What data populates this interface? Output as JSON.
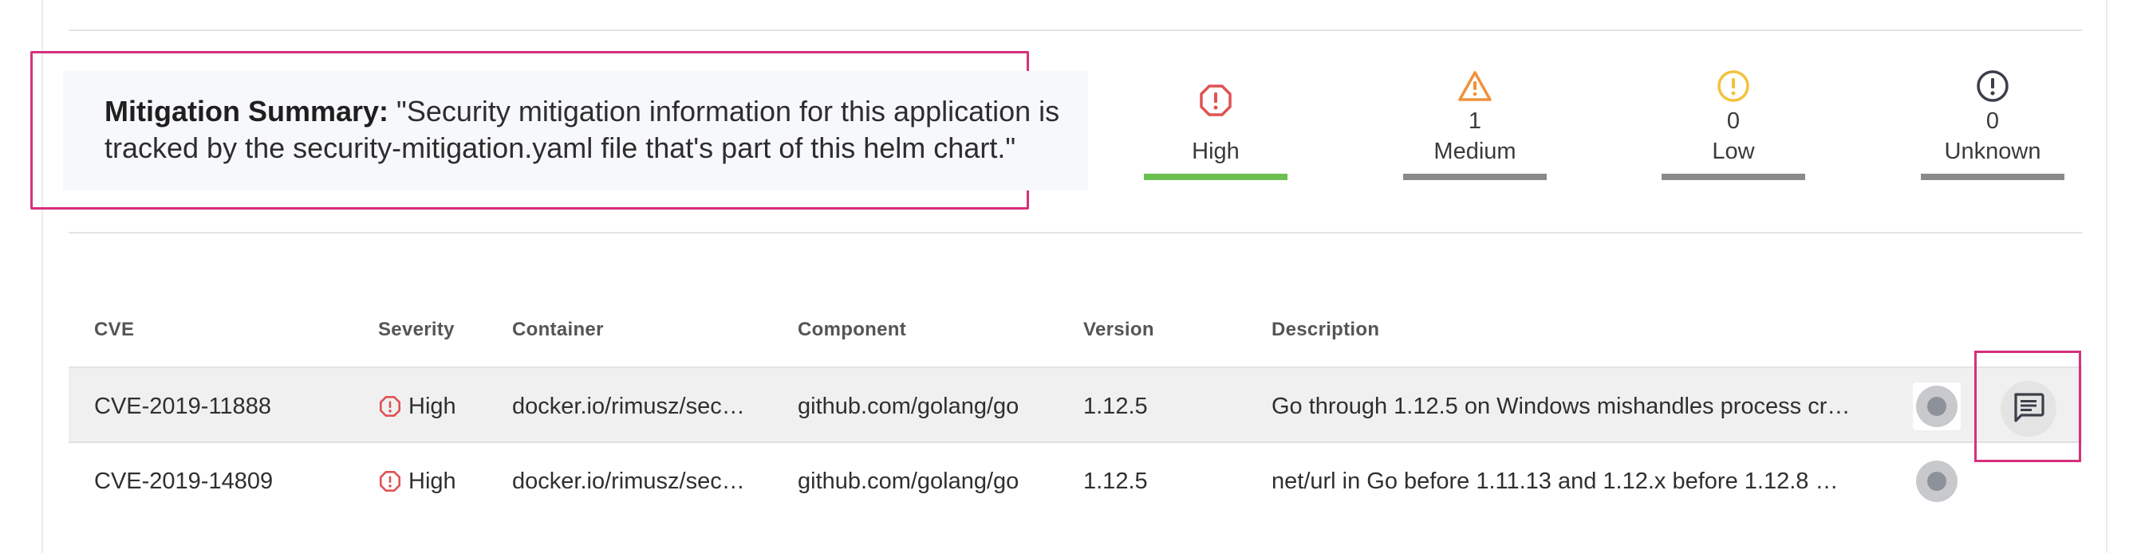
{
  "summary": {
    "label": "Mitigation Summary:",
    "text": " \"Security mitigation information for this application is tracked by the security-mitigation.yaml file that's part of this helm chart.\""
  },
  "severity_counts": [
    {
      "name": "High",
      "count": "",
      "icon": "octagon-exclamation-icon",
      "color": "#e05252",
      "active": true
    },
    {
      "name": "Medium",
      "count": "1",
      "icon": "triangle-warning-icon",
      "color": "#f0913a",
      "active": false
    },
    {
      "name": "Low",
      "count": "0",
      "icon": "circle-exclamation-icon",
      "color": "#f2c23c",
      "active": false
    },
    {
      "name": "Unknown",
      "count": "0",
      "icon": "circle-exclamation-icon",
      "color": "#3a3f4a",
      "active": false
    }
  ],
  "table": {
    "headers": {
      "cve": "CVE",
      "severity": "Severity",
      "container": "Container",
      "component": "Component",
      "version": "Version",
      "description": "Description"
    },
    "rows": [
      {
        "cve": "CVE-2019-11888",
        "severity": "High",
        "container": "docker.io/rimusz/sec…",
        "component": "github.com/golang/go",
        "version": "1.12.5",
        "description": "Go through 1.12.5 on Windows mishandles process cr…"
      },
      {
        "cve": "CVE-2019-14809",
        "severity": "High",
        "container": "docker.io/rimusz/sec…",
        "component": "github.com/golang/go",
        "version": "1.12.5",
        "description": "net/url in Go before 1.11.13 and 1.12.x before 1.12.8 …"
      }
    ]
  },
  "colors": {
    "highlight_border": "#d6307c",
    "active_tab": "#6bbf4e",
    "high": "#e05252"
  }
}
